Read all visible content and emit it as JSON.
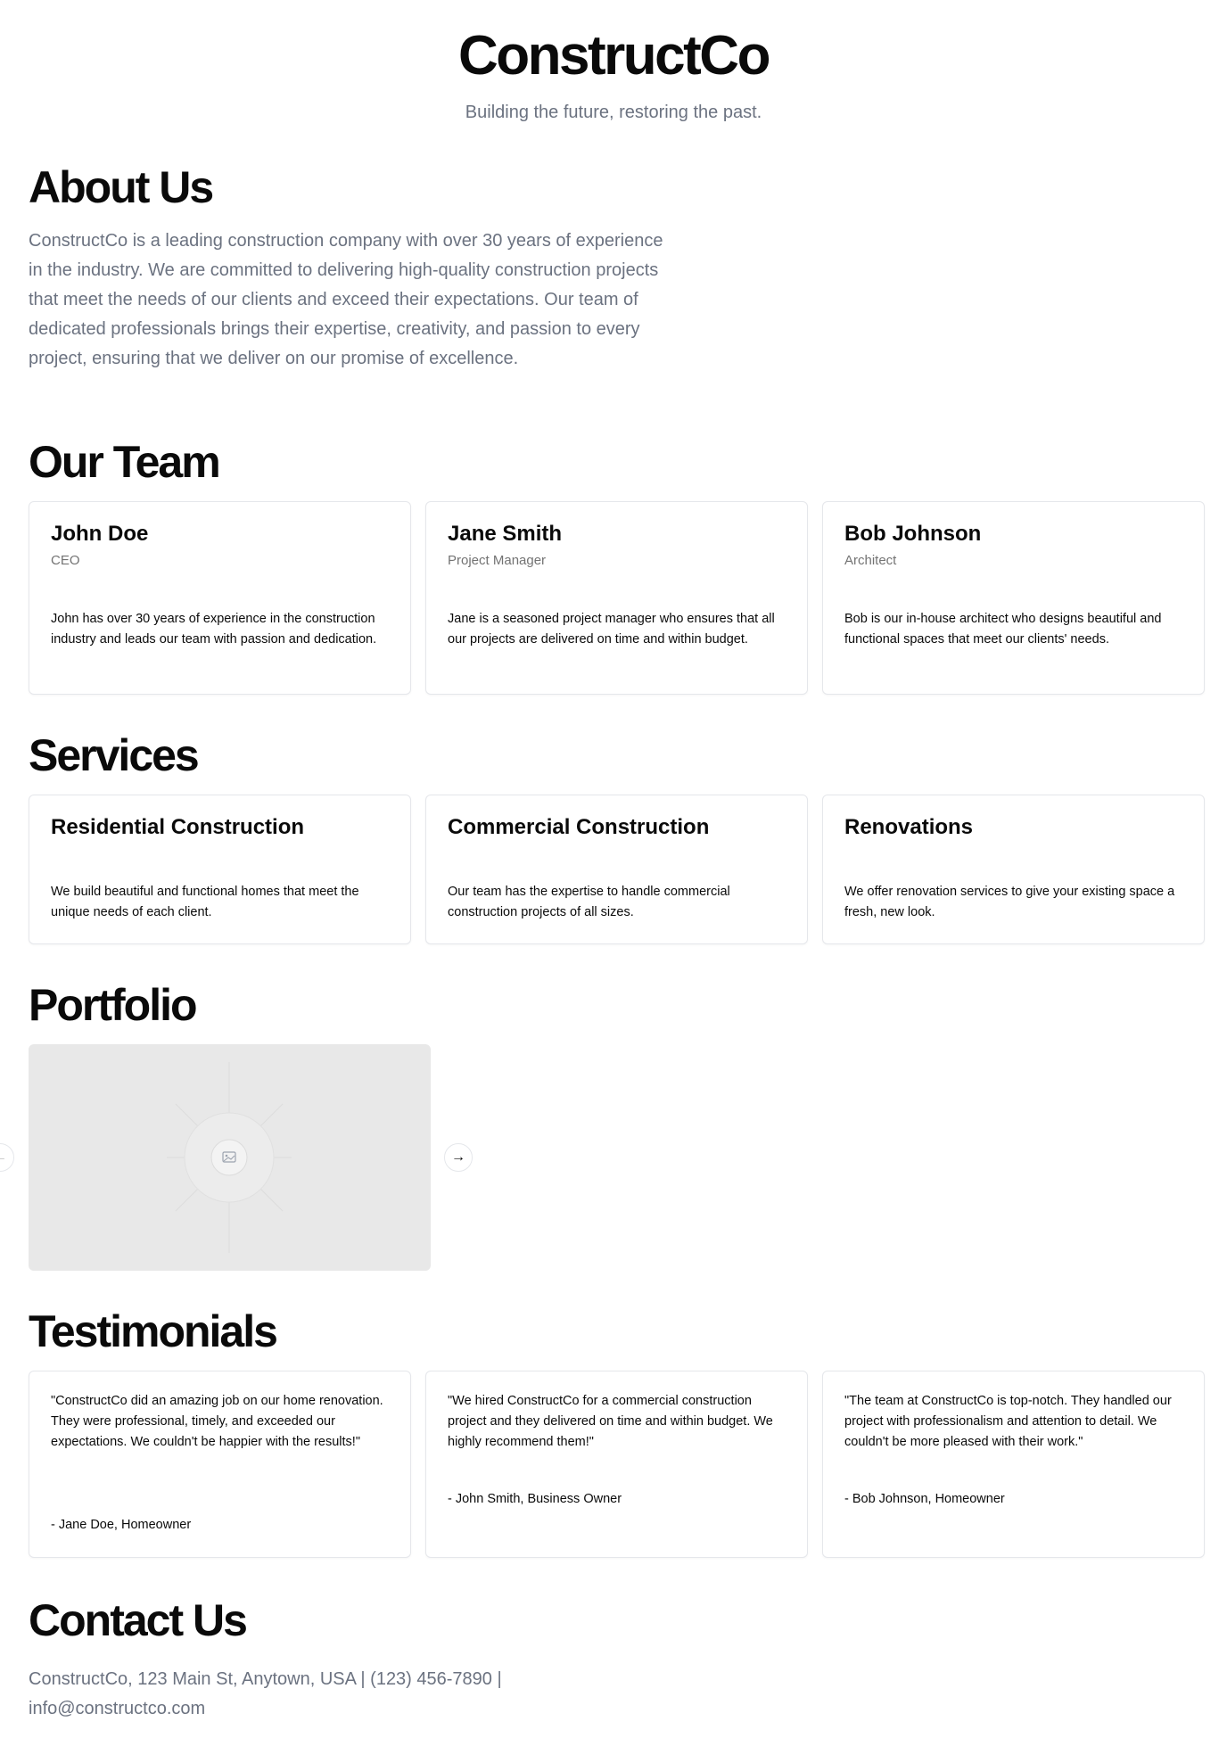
{
  "header": {
    "brand": "ConstructCo",
    "tagline": "Building the future, restoring the past."
  },
  "about": {
    "title": "About Us",
    "text": "ConstructCo is a leading construction company with over 30 years of experience in the industry. We are committed to delivering high-quality construction projects that meet the needs of our clients and exceed their expectations. Our team of dedicated professionals brings their expertise, creativity, and passion to every project, ensuring that we deliver on our promise of excellence."
  },
  "team": {
    "title": "Our Team",
    "members": [
      {
        "name": "John Doe",
        "role": "CEO",
        "bio": "John has over 30 years of experience in the construction industry and leads our team with passion and dedication."
      },
      {
        "name": "Jane Smith",
        "role": "Project Manager",
        "bio": "Jane is a seasoned project manager who ensures that all our projects are delivered on time and within budget."
      },
      {
        "name": "Bob Johnson",
        "role": "Architect",
        "bio": "Bob is our in-house architect who designs beautiful and functional spaces that meet our clients' needs."
      }
    ]
  },
  "services": {
    "title": "Services",
    "items": [
      {
        "name": "Residential Construction",
        "description": "We build beautiful and functional homes that meet the unique needs of each client."
      },
      {
        "name": "Commercial Construction",
        "description": "Our team has the expertise to handle commercial construction projects of all sizes."
      },
      {
        "name": "Renovations",
        "description": "We offer renovation services to give your existing space a fresh, new look."
      }
    ]
  },
  "portfolio": {
    "title": "Portfolio",
    "prev_icon": "arrow-left-icon",
    "next_icon": "arrow-right-icon",
    "placeholder_icon": "image-icon"
  },
  "testimonials": {
    "title": "Testimonials",
    "items": [
      {
        "quote": "\"ConstructCo did an amazing job on our home renovation. They were professional, timely, and exceeded our expectations. We couldn't be happier with the results!\"",
        "author": "- Jane Doe, Homeowner"
      },
      {
        "quote": "\"We hired ConstructCo for a commercial construction project and they delivered on time and within budget. We highly recommend them!\"",
        "author": "- John Smith, Business Owner"
      },
      {
        "quote": "\"The team at ConstructCo is top-notch. They handled our project with professionalism and attention to detail. We couldn't be more pleased with their work.\"",
        "author": "- Bob Johnson, Homeowner"
      }
    ]
  },
  "contact": {
    "title": "Contact Us",
    "text": "ConstructCo, 123 Main St, Anytown, USA | (123) 456-7890 | info@constructco.com"
  }
}
